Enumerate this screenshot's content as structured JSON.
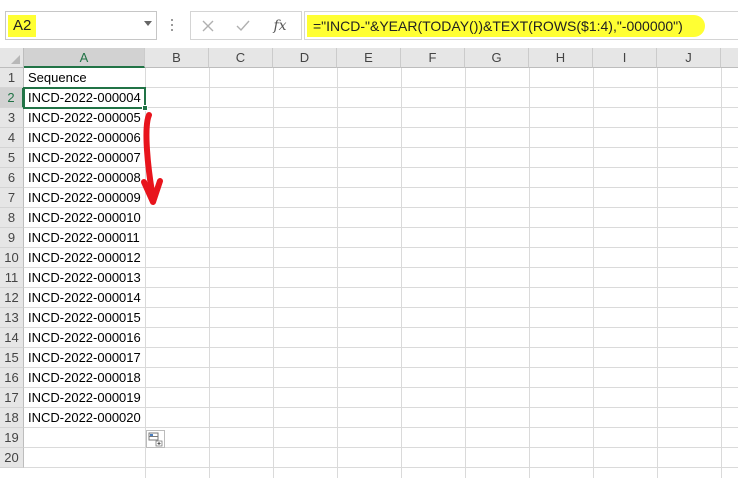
{
  "namebox": {
    "value": "A2"
  },
  "formula": {
    "text": "=\"INCD-\"&YEAR(TODAY())&TEXT(ROWS($1:4),\"-000000\")"
  },
  "icons": {
    "cancel": "close-icon",
    "enter": "check-icon",
    "function": "fx-icon",
    "quick_analysis": "quick-analysis-icon"
  },
  "buttons": {
    "fx_label": "fx"
  },
  "columns": [
    "A",
    "B",
    "C",
    "D",
    "E",
    "F",
    "G",
    "H",
    "I",
    "J"
  ],
  "rows": [
    "1",
    "2",
    "3",
    "4",
    "5",
    "6",
    "7",
    "8",
    "9",
    "10",
    "11",
    "12",
    "13",
    "14",
    "15",
    "16",
    "17",
    "18",
    "19",
    "20"
  ],
  "cells": [
    "Sequence",
    "INCD-2022-000004",
    "INCD-2022-000005",
    "INCD-2022-000006",
    "INCD-2022-000007",
    "INCD-2022-000008",
    "INCD-2022-000009",
    "INCD-2022-000010",
    "INCD-2022-000011",
    "INCD-2022-000012",
    "INCD-2022-000013",
    "INCD-2022-000014",
    "INCD-2022-000015",
    "INCD-2022-000016",
    "INCD-2022-000017",
    "INCD-2022-000018",
    "INCD-2022-000019",
    "INCD-2022-000020"
  ],
  "colors": {
    "highlight": "#ffff33",
    "selection": "#217346",
    "annotation": "#e8141c"
  }
}
